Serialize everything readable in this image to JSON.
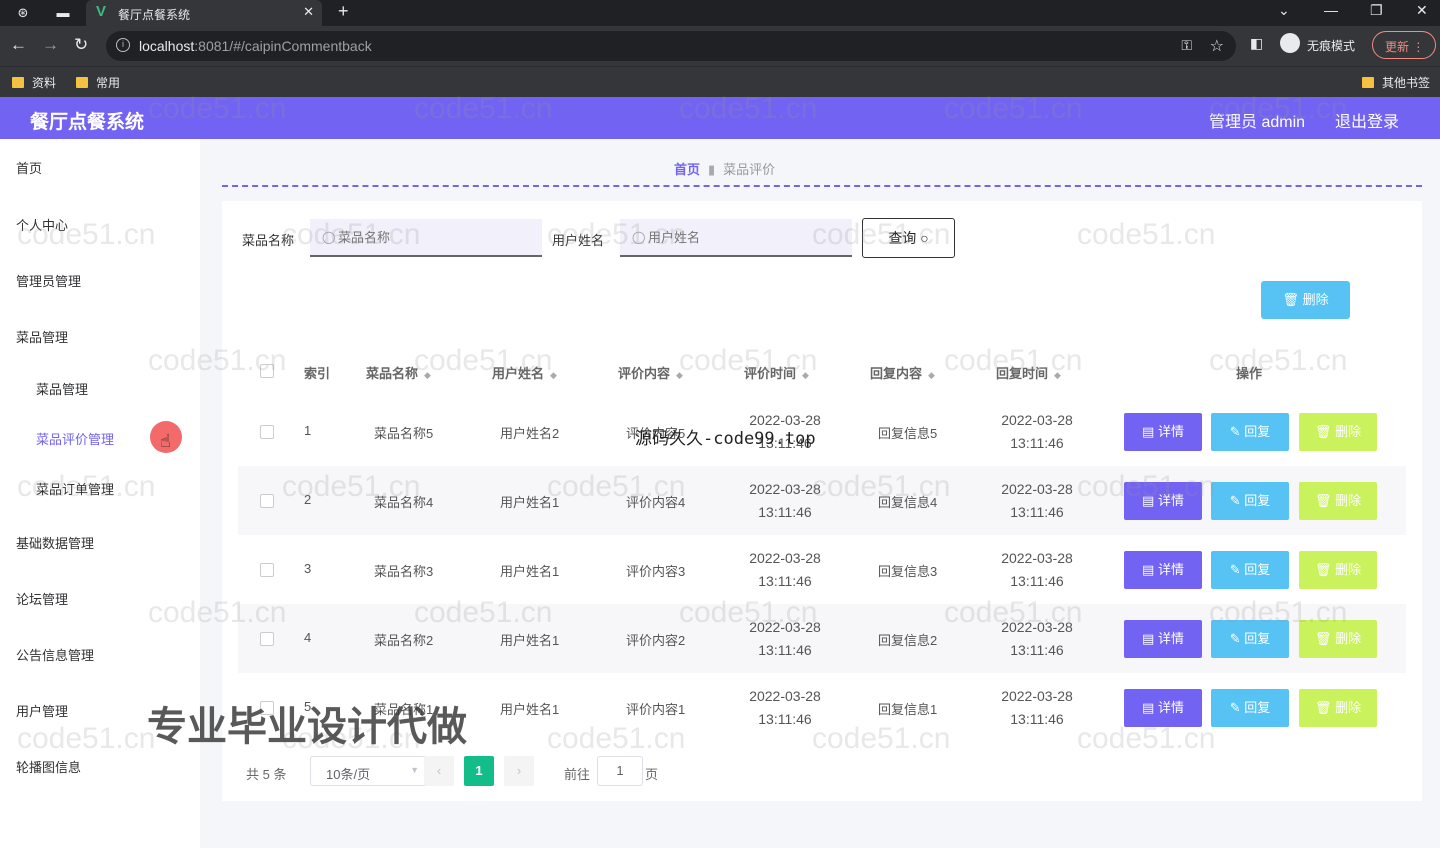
{
  "browser": {
    "tab_title": "餐厅点餐系统",
    "url_host": "localhost",
    "url_rest": ":8081/#/caipinCommentback",
    "incognito_label": "无痕模式",
    "update_label": "更新",
    "bookmarks": [
      "资料",
      "常用"
    ],
    "other_bookmarks": "其他书签"
  },
  "header": {
    "title": "餐厅点餐系统",
    "user": "管理员 admin",
    "logout": "退出登录"
  },
  "sidebar": {
    "items": [
      {
        "label": "首页"
      },
      {
        "label": "个人中心"
      },
      {
        "label": "管理员管理"
      },
      {
        "label": "菜品管理"
      },
      {
        "label": "菜品管理"
      },
      {
        "label": "菜品评价管理"
      },
      {
        "label": "菜品订单管理"
      },
      {
        "label": "基础数据管理"
      },
      {
        "label": "论坛管理"
      },
      {
        "label": "公告信息管理"
      },
      {
        "label": "用户管理"
      },
      {
        "label": "轮播图信息"
      }
    ]
  },
  "breadcrumb": {
    "home": "首页",
    "current": "菜品评价"
  },
  "search": {
    "dish_label": "菜品名称",
    "dish_placeholder": "菜品名称",
    "user_label": "用户姓名",
    "user_placeholder": "用户姓名",
    "query_label": "查询"
  },
  "batch_delete_label": "删除",
  "table": {
    "columns": [
      "索引",
      "菜品名称",
      "用户姓名",
      "评价内容",
      "评价时间",
      "回复内容",
      "回复时间",
      "操作"
    ],
    "rows": [
      {
        "index": "1",
        "dish": "菜品名称5",
        "user": "用户姓名2",
        "comment": "评价内容5",
        "time": "2022-03-28 13:11:46",
        "reply": "回复信息5",
        "reply_time": "2022-03-28 13:11:46"
      },
      {
        "index": "2",
        "dish": "菜品名称4",
        "user": "用户姓名1",
        "comment": "评价内容4",
        "time": "2022-03-28 13:11:46",
        "reply": "回复信息4",
        "reply_time": "2022-03-28 13:11:46"
      },
      {
        "index": "3",
        "dish": "菜品名称3",
        "user": "用户姓名1",
        "comment": "评价内容3",
        "time": "2022-03-28 13:11:46",
        "reply": "回复信息3",
        "reply_time": "2022-03-28 13:11:46"
      },
      {
        "index": "4",
        "dish": "菜品名称2",
        "user": "用户姓名1",
        "comment": "评价内容2",
        "time": "2022-03-28 13:11:46",
        "reply": "回复信息2",
        "reply_time": "2022-03-28 13:11:46"
      },
      {
        "index": "5",
        "dish": "菜品名称1",
        "user": "用户姓名1",
        "comment": "评价内容1",
        "time": "2022-03-28 13:11:46",
        "reply": "回复信息1",
        "reply_time": "2022-03-28 13:11:46"
      }
    ],
    "actions": {
      "detail": "详情",
      "reply": "回复",
      "delete": "删除"
    }
  },
  "pagination": {
    "total": "共 5 条",
    "page_size": "10条/页",
    "current_page": "1",
    "goto_label": "前往",
    "goto_value": "1",
    "page_unit": "页"
  },
  "overlays": {
    "watermark": "code51.cn",
    "source_text": "源码久久-code99.top",
    "promo_text": "专业毕业设计代做"
  },
  "colors": {
    "header": "#7263f3",
    "detail_button": "#7263f3",
    "reply_button": "#56c3f4",
    "delete_button": "#c9f25c",
    "current_page": "#13bd8a"
  }
}
